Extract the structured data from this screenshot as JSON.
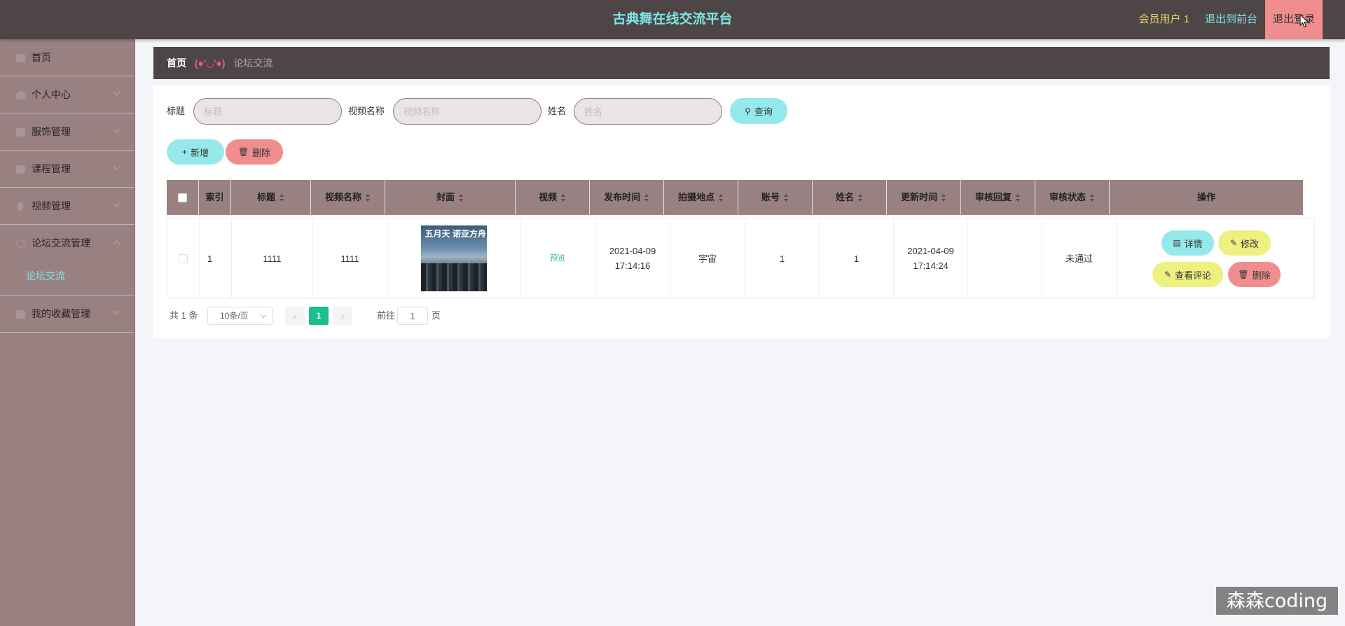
{
  "header": {
    "title": "古典舞在线交流平台",
    "user": "会员用户 1",
    "front_link": "退出到前台",
    "logout": "退出登录"
  },
  "sidebar": {
    "items": [
      {
        "label": "首页",
        "icon": "home-icon"
      },
      {
        "label": "个人中心",
        "icon": "user-icon"
      },
      {
        "label": "服饰管理",
        "icon": "grid-icon"
      },
      {
        "label": "课程管理",
        "icon": "grid-icon"
      },
      {
        "label": "视频管理",
        "icon": "video-icon"
      },
      {
        "label": "论坛交流管理",
        "icon": "circle-icon"
      },
      {
        "label": "我的收藏管理",
        "icon": "grid-icon"
      }
    ],
    "sub_items": [
      {
        "label": "论坛交流"
      }
    ]
  },
  "breadcrumb": {
    "home": "首页",
    "separator": "(●'◡'●)",
    "current": "论坛交流"
  },
  "search": {
    "title_label": "标题",
    "title_placeholder": "标题",
    "video_label": "视频名称",
    "video_placeholder": "视频名称",
    "name_label": "姓名",
    "name_placeholder": "姓名",
    "query_button": "查询"
  },
  "actions": {
    "add": "新增",
    "delete": "删除"
  },
  "table": {
    "columns": [
      "索引",
      "标题",
      "视频名称",
      "封面",
      "视频",
      "发布时间",
      "拍摄地点",
      "账号",
      "姓名",
      "更新时间",
      "审核回复",
      "审核状态",
      "操作"
    ],
    "rows": [
      {
        "index": "1",
        "title": "1111",
        "video_name": "1111",
        "cover_text": "五月天 诺亚方舟",
        "video": "预览",
        "publish_time": "2021-04-09 17:14:16",
        "location": "宇宙",
        "account": "1",
        "name": "1",
        "update_time": "2021-04-09 17:14:24",
        "review_reply": "",
        "review_status": "未通过",
        "ops": {
          "detail": "详情",
          "edit": "修改",
          "comments": "查看评论",
          "delete": "删除"
        }
      }
    ]
  },
  "pagination": {
    "total": "共 1 条",
    "page_size": "10条/页",
    "current_page": "1",
    "goto": "前往",
    "jump_value": "1",
    "page_unit": "页"
  },
  "watermark": "森森coding",
  "colors": {
    "header_bg": "#4d4546",
    "sidebar_bg": "#998182",
    "accent_cyan": "#95e9ea",
    "accent_pink": "#f08d8e",
    "accent_yellow": "#eef080",
    "page_active": "#1dbe8e"
  }
}
